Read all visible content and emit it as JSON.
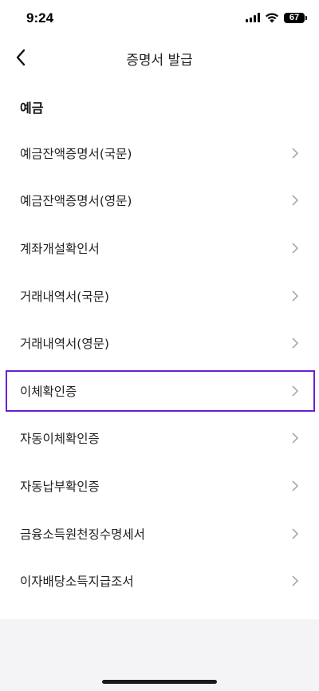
{
  "status_bar": {
    "time": "9:24",
    "battery": "67"
  },
  "header": {
    "title": "증명서 발급",
    "back_icon": "chevron-left-icon"
  },
  "section": {
    "title": "예금"
  },
  "items": [
    {
      "label": "예금잔액증명서(국문)"
    },
    {
      "label": "예금잔액증명서(영문)"
    },
    {
      "label": "계좌개설확인서"
    },
    {
      "label": "거래내역서(국문)"
    },
    {
      "label": "거래내역서(영문)"
    },
    {
      "label": "이체확인증",
      "highlighted": true
    },
    {
      "label": "자동이체확인증"
    },
    {
      "label": "자동납부확인증"
    },
    {
      "label": "금융소득원천징수명세서"
    },
    {
      "label": "이자배당소득지급조서"
    }
  ],
  "colors": {
    "highlight": "#6a1fd1",
    "chevron": "#9a9a9a",
    "footer_bg": "#f4f4f6"
  }
}
